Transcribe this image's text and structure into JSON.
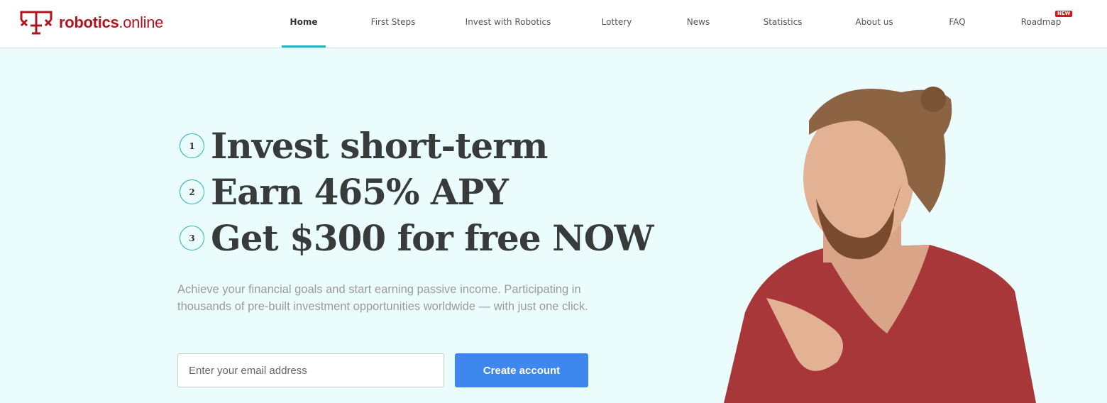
{
  "brand": {
    "name_bold": "robotics",
    "name_light": ".online",
    "color": "#b0141f"
  },
  "nav": {
    "items": [
      {
        "label": "Home",
        "active": true
      },
      {
        "label": "First Steps"
      },
      {
        "label": "Invest with Robotics"
      },
      {
        "label": "Lottery"
      },
      {
        "label": "News"
      },
      {
        "label": "Statistics"
      },
      {
        "label": "About us"
      },
      {
        "label": "FAQ"
      },
      {
        "label": "Roadmap",
        "badge": "NEW"
      }
    ]
  },
  "hero": {
    "steps": [
      {
        "num": "1",
        "text": "Invest short-term"
      },
      {
        "num": "2",
        "text": "Earn 465% APY"
      },
      {
        "num": "3",
        "text": "Get $300 for free NOW"
      }
    ],
    "description": "Achieve your financial goals and start earning passive income. Participating in thousands of pre-built investment opportunities worldwide — with just one click.",
    "email_placeholder": "Enter your email address",
    "cta_label": "Create account"
  },
  "colors": {
    "accent": "#2bb3c0",
    "button": "#3d87ef",
    "background": "#ebfcfc"
  }
}
